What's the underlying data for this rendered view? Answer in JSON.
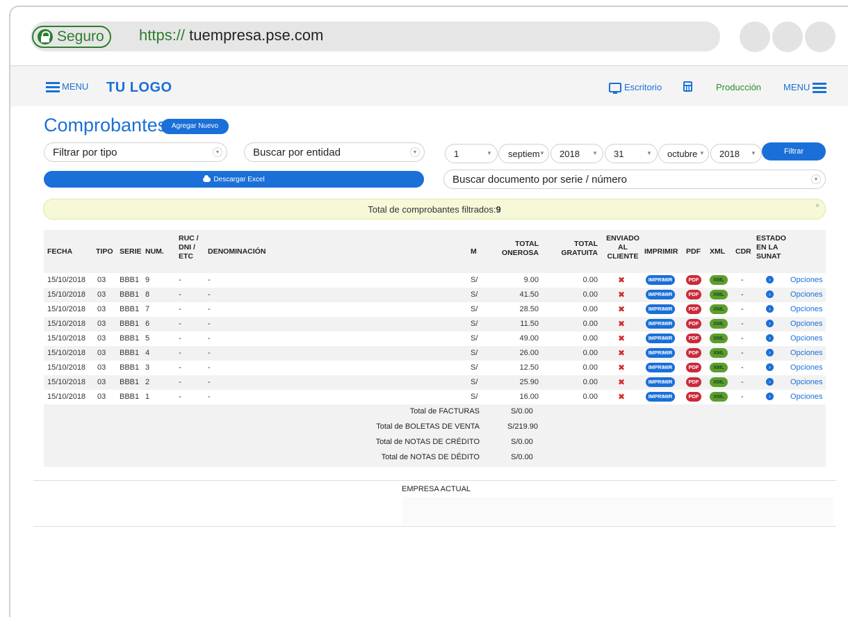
{
  "browser": {
    "secure_label": "Seguro",
    "url_scheme": "https://",
    "url_host": " tuempresa.pse.com"
  },
  "nav": {
    "menu_left": "MENU",
    "logo": "TU LOGO",
    "escritorio": "Escritorio",
    "produccion": "Producción",
    "menu_right": "MENU"
  },
  "page": {
    "title": "Comprobantes",
    "add_new": "Agregar Nuevo"
  },
  "filters": {
    "tipo": "Filtrar por tipo",
    "entidad": "Buscar por entidad",
    "from_day": "1",
    "from_month": "septiem",
    "from_year": "2018",
    "to_day": "31",
    "to_month": "octubre",
    "to_year": "2018",
    "filter_button": "Filtrar",
    "excel_button": "Descargar Excel",
    "doc_search": "Buscar documento por serie / número"
  },
  "alert": {
    "text": "Total de comprobantes filtrados: ",
    "count": "9",
    "close": "×"
  },
  "table": {
    "headers": {
      "fecha": "FECHA",
      "tipo": "TIPO",
      "serie": "SERIE",
      "num": "NUM.",
      "ruc_1": "RUC /",
      "ruc_2": "DNI /",
      "ruc_3": "ETC",
      "denominacion": "DENOMINACIÓN",
      "m": "M",
      "onerosa_1": "TOTAL",
      "onerosa_2": "ONEROSA",
      "gratuita_1": "TOTAL",
      "gratuita_2": "GRATUITA",
      "enviado_1": "ENVIADO",
      "enviado_2": "AL",
      "enviado_3": "CLIENTE",
      "imprimir": "IMPRIMIR",
      "pdf": "PDF",
      "xml": "XML",
      "cdr": "CDR",
      "estado_1": "ESTADO",
      "estado_2": "EN LA",
      "estado_3": "SUNAT"
    },
    "rows": [
      {
        "fecha": "15/10/2018",
        "tipo": "03",
        "serie": "BBB1",
        "num": "9",
        "ruc": "-",
        "denom": "-",
        "m": "S/",
        "onerosa": "9.00",
        "gratuita": "0.00",
        "enviado": "✖",
        "imprimir": "IMPRIMIR",
        "pdf": "PDF",
        "xml": "XML",
        "cdr": "-",
        "estado": "›",
        "opciones": "Opciones"
      },
      {
        "fecha": "15/10/2018",
        "tipo": "03",
        "serie": "BBB1",
        "num": "8",
        "ruc": "-",
        "denom": "-",
        "m": "S/",
        "onerosa": "41.50",
        "gratuita": "0.00",
        "enviado": "✖",
        "imprimir": "IMPRIMIR",
        "pdf": "PDF",
        "xml": "XML",
        "cdr": "-",
        "estado": "›",
        "opciones": "Opciones"
      },
      {
        "fecha": "15/10/2018",
        "tipo": "03",
        "serie": "BBB1",
        "num": "7",
        "ruc": "-",
        "denom": "-",
        "m": "S/",
        "onerosa": "28.50",
        "gratuita": "0.00",
        "enviado": "✖",
        "imprimir": "IMPRIMIR",
        "pdf": "PDF",
        "xml": "XML",
        "cdr": "-",
        "estado": "›",
        "opciones": "Opciones"
      },
      {
        "fecha": "15/10/2018",
        "tipo": "03",
        "serie": "BBB1",
        "num": "6",
        "ruc": "-",
        "denom": "-",
        "m": "S/",
        "onerosa": "11.50",
        "gratuita": "0.00",
        "enviado": "✖",
        "imprimir": "IMPRIMIR",
        "pdf": "PDF",
        "xml": "XML",
        "cdr": "-",
        "estado": "›",
        "opciones": "Opciones"
      },
      {
        "fecha": "15/10/2018",
        "tipo": "03",
        "serie": "BBB1",
        "num": "5",
        "ruc": "-",
        "denom": "-",
        "m": "S/",
        "onerosa": "49.00",
        "gratuita": "0.00",
        "enviado": "✖",
        "imprimir": "IMPRIMIR",
        "pdf": "PDF",
        "xml": "XML",
        "cdr": "-",
        "estado": "›",
        "opciones": "Opciones"
      },
      {
        "fecha": "15/10/2018",
        "tipo": "03",
        "serie": "BBB1",
        "num": "4",
        "ruc": "-",
        "denom": "-",
        "m": "S/",
        "onerosa": "26.00",
        "gratuita": "0.00",
        "enviado": "✖",
        "imprimir": "IMPRIMIR",
        "pdf": "PDF",
        "xml": "XML",
        "cdr": "-",
        "estado": "›",
        "opciones": "Opciones"
      },
      {
        "fecha": "15/10/2018",
        "tipo": "03",
        "serie": "BBB1",
        "num": "3",
        "ruc": "-",
        "denom": "-",
        "m": "S/",
        "onerosa": "12.50",
        "gratuita": "0.00",
        "enviado": "✖",
        "imprimir": "IMPRIMIR",
        "pdf": "PDF",
        "xml": "XML",
        "cdr": "-",
        "estado": "›",
        "opciones": "Opciones"
      },
      {
        "fecha": "15/10/2018",
        "tipo": "03",
        "serie": "BBB1",
        "num": "2",
        "ruc": "-",
        "denom": "-",
        "m": "S/",
        "onerosa": "25.90",
        "gratuita": "0.00",
        "enviado": "✖",
        "imprimir": "IMPRIMIR",
        "pdf": "PDF",
        "xml": "XML",
        "cdr": "-",
        "estado": "›",
        "opciones": "Opciones"
      },
      {
        "fecha": "15/10/2018",
        "tipo": "03",
        "serie": "BBB1",
        "num": "1",
        "ruc": "-",
        "denom": "-",
        "m": "S/",
        "onerosa": "16.00",
        "gratuita": "0.00",
        "enviado": "✖",
        "imprimir": "IMPRIMIR",
        "pdf": "PDF",
        "xml": "XML",
        "cdr": "-",
        "estado": "›",
        "opciones": "Opciones"
      }
    ],
    "totals": [
      {
        "label": "Total de FACTURAS",
        "value": "S/0.00"
      },
      {
        "label": "Total de BOLETAS DE VENTA",
        "value": "S/219.90"
      },
      {
        "label": "Total de NOTAS DE CRÉDITO",
        "value": "S/0.00"
      },
      {
        "label": "Total de NOTAS DE DÉDITO",
        "value": "S/0.00"
      }
    ]
  },
  "footer": {
    "empresa": "EMPRESA ACTUAL"
  },
  "colors": {
    "accent": "#1a6fd8",
    "secure_green": "#2d7d2d",
    "produccion_green": "#2d8c2d",
    "pdf_red": "#cc2a3a",
    "xml_green": "#5d9e2a",
    "alert_bg": "#f6f8d8"
  }
}
